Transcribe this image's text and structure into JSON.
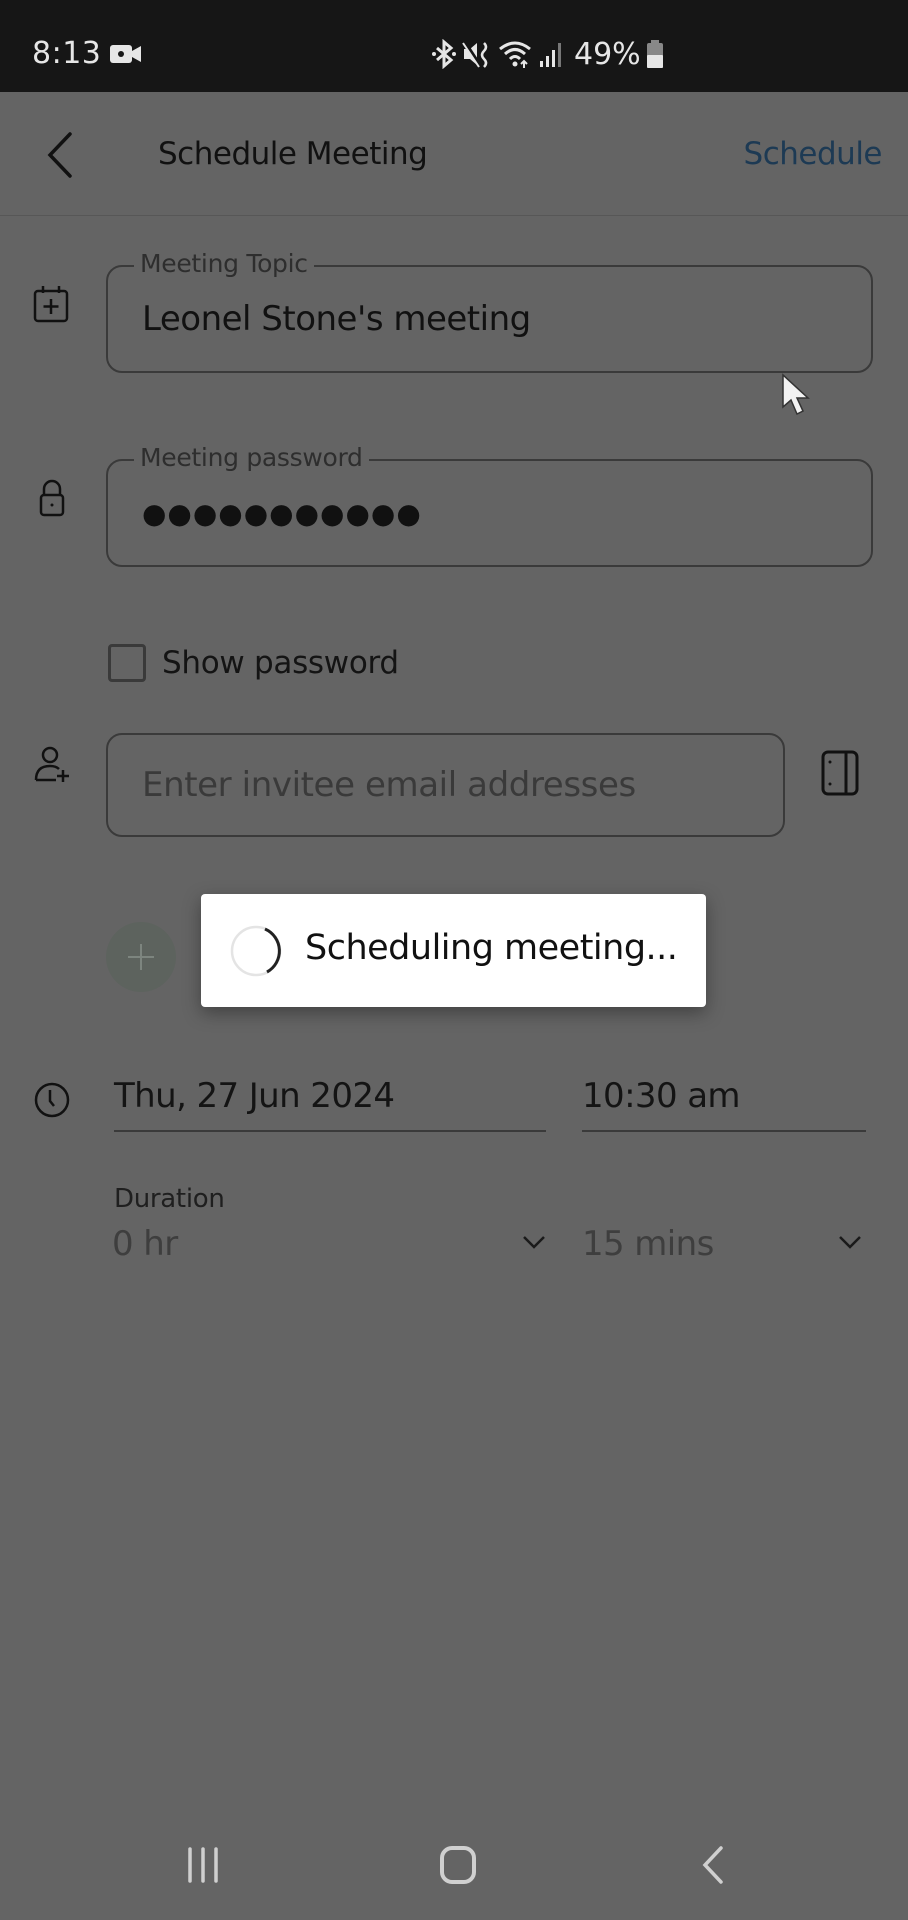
{
  "status_bar": {
    "time": "8:13",
    "battery_percent": "49%",
    "icons": [
      "video-recording-icon",
      "bluetooth-icon",
      "vibrate-mute-icon",
      "wifi-icon",
      "signal-icon",
      "battery-icon"
    ]
  },
  "app_bar": {
    "title": "Schedule Meeting",
    "action_label": "Schedule",
    "action_color": "#1d3a54"
  },
  "form": {
    "topic": {
      "label": "Meeting Topic",
      "value": "Leonel Stone's meeting"
    },
    "password": {
      "label": "Meeting password",
      "value_masked": "●●●●●●●●●●●"
    },
    "show_password": {
      "label": "Show password",
      "checked": false
    },
    "invitees": {
      "placeholder": "Enter invitee email addresses",
      "value": ""
    },
    "date": "Thu, 27 Jun 2024",
    "time": "10:30 am",
    "duration": {
      "label": "Duration",
      "hours": "0 hr",
      "minutes": "15 mins"
    }
  },
  "dialog": {
    "message": "Scheduling meeting..."
  },
  "nav_bar": {
    "buttons": [
      "recent-apps",
      "home",
      "back"
    ]
  }
}
